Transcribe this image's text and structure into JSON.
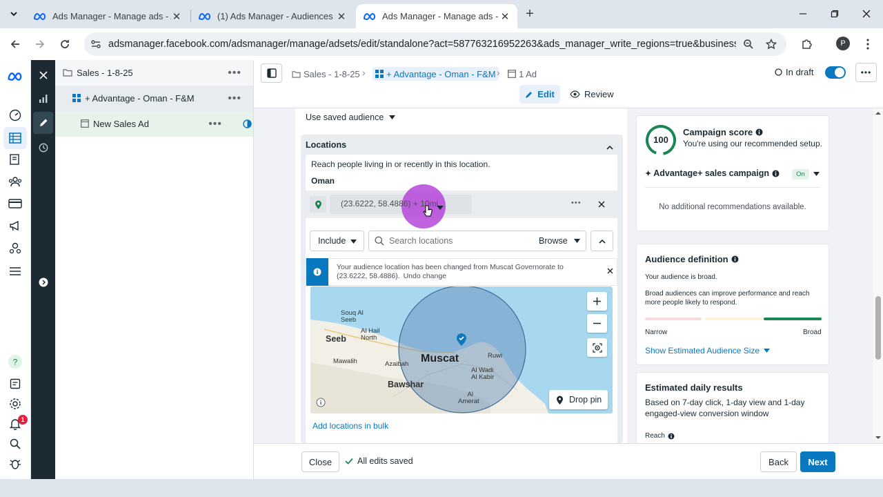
{
  "browser": {
    "tabs": [
      {
        "title": "Ads Manager - Manage ads - A",
        "active": false
      },
      {
        "title": "(1) Ads Manager - Audiences",
        "active": false
      },
      {
        "title": "Ads Manager - Manage ads - A",
        "active": true
      }
    ],
    "url": "adsmanager.facebook.com/adsmanager/manage/adsets/edit/standalone?act=587763216952263&ads_manager_write_regions=true&business_id...",
    "profile_initial": "P"
  },
  "notifications_count": "1",
  "tree": {
    "campaign": "Sales - 1-8-25",
    "adset": "+ Advantage - Oman - F&M",
    "ad": "New Sales Ad"
  },
  "breadcrumb": {
    "campaign": "Sales - 1-8-25",
    "adset": "+ Advantage - Oman - F&M",
    "ad": "1 Ad"
  },
  "status": "In draft",
  "modes": {
    "edit": "Edit",
    "review": "Review"
  },
  "audience": {
    "saved_audience": "Use saved audience",
    "locations_title": "Locations",
    "reach_text": "Reach people living in or recently in this location.",
    "country": "Oman",
    "pin_label": "(23.6222, 58.4886) + 10mi",
    "include": "Include",
    "search_placeholder": "Search locations",
    "browse": "Browse",
    "notice": "Your audience location has been changed from Muscat Governorate to (23.6222, 58.4886).",
    "undo": "Undo change",
    "drop_pin": "Drop pin",
    "add_bulk": "Add locations in bulk",
    "map_labels": [
      "Souq Al Seeb",
      "Al Hail North",
      "Seeb",
      "Mawalih",
      "Azaibah",
      "Muscat",
      "Ruwi",
      "Al Wadi Al Kabir",
      "Bawshar",
      "Al Amerat"
    ]
  },
  "score": {
    "value": "100",
    "title": "Campaign score",
    "subtitle": "You're using our recommended setup.",
    "advantage": "Advantage+ sales campaign",
    "toggle": "On",
    "no_recs": "No additional recommendations available."
  },
  "definition": {
    "title": "Audience definition",
    "broad_text": "Your audience is broad.",
    "explain": "Broad audiences can improve performance and reach more people likely to respond.",
    "narrow": "Narrow",
    "broad": "Broad",
    "show_size": "Show Estimated Audience Size"
  },
  "daily": {
    "title": "Estimated daily results",
    "desc": "Based on 7-day click, 1-day view and 1-day engaged-view conversion window",
    "reach": "Reach"
  },
  "footer": {
    "close": "Close",
    "saved": "All edits saved",
    "back": "Back",
    "next": "Next"
  },
  "colors": {
    "accent": "#0a78be",
    "meta_blue": "#0866ff",
    "green": "#1b8655",
    "cursor_highlight": "#b545d9"
  }
}
